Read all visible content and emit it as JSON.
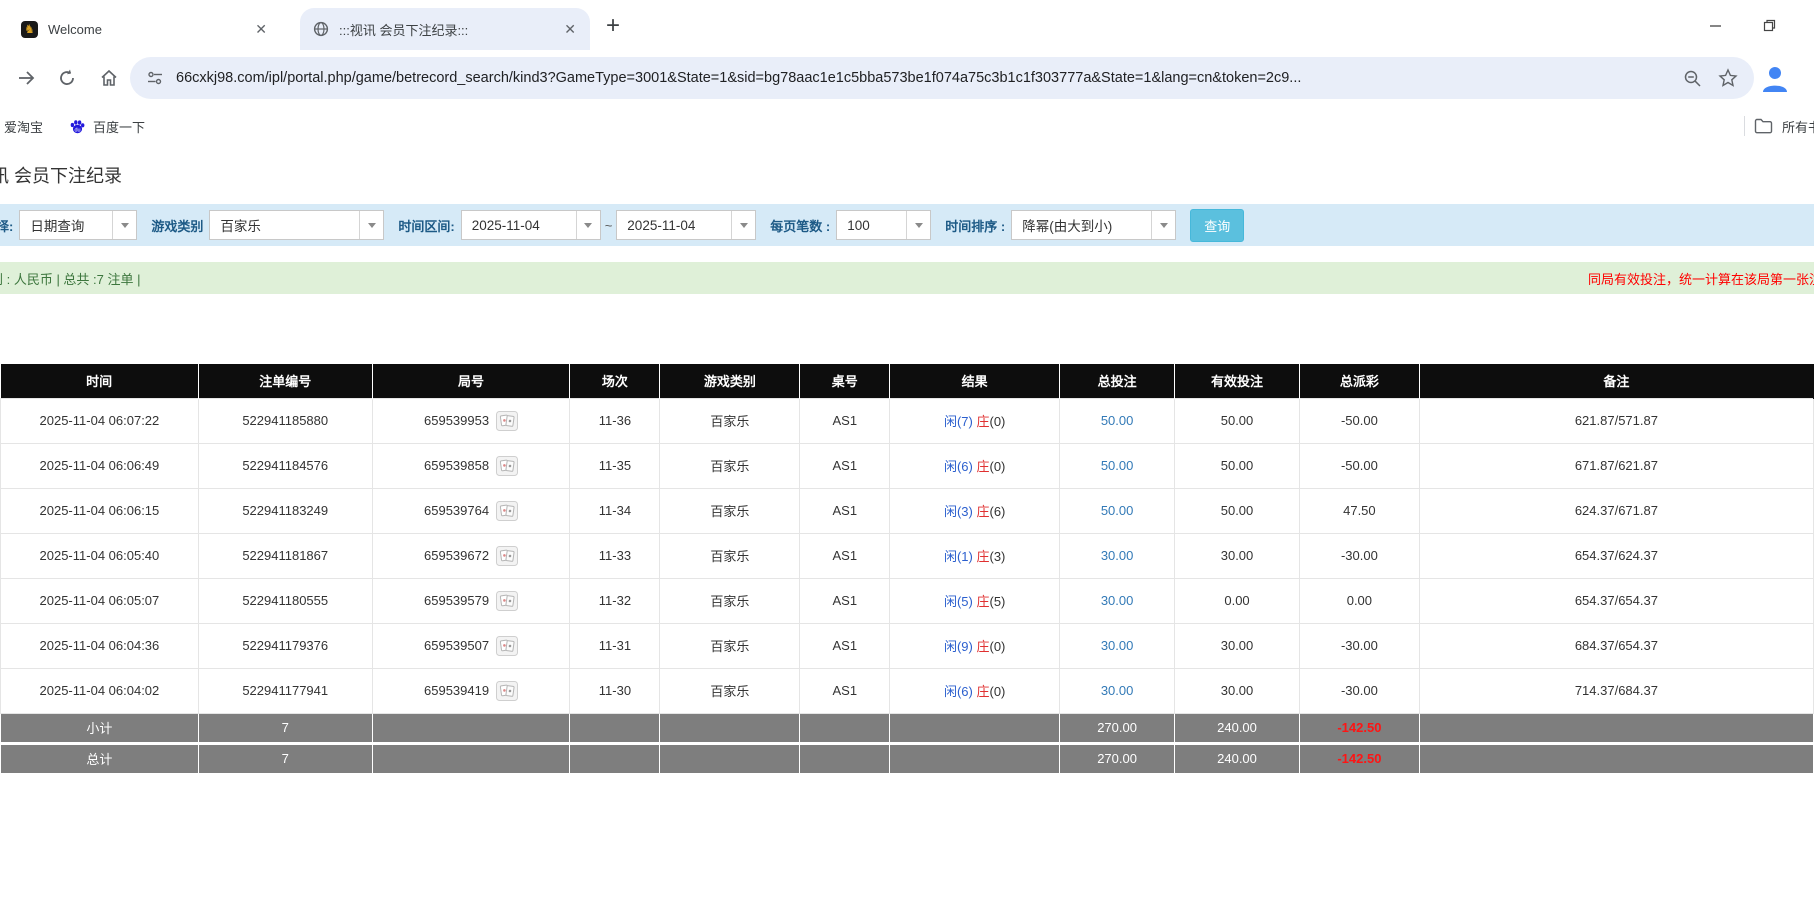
{
  "browser": {
    "tabs": [
      {
        "title": "Welcome",
        "favicon": "gold-emblem-icon"
      },
      {
        "title": ":::视讯 会员下注纪录:::",
        "favicon": "globe-icon"
      }
    ],
    "url": "66cxkj98.com/ipl/portal.php/game/betrecord_search/kind3?GameType=3001&State=1&sid=bg78aac1e1c5bba573be1f074a75c3b1c1f303777a&State=1&lang=cn&token=2c9...",
    "bookmarks": {
      "item1": "爱淘宝",
      "item2": "百度一下",
      "all_bookmarks": "所有书签"
    }
  },
  "page": {
    "heading": "讯 会员下注纪录",
    "filters": {
      "select_label": "择:",
      "query_type": "日期查询",
      "game_category_label": "游戏类别",
      "game_category": "百家乐",
      "date_range_label": "时间区间:",
      "date_from": "2025-11-04",
      "tilde": "~",
      "date_to": "2025-11-04",
      "page_size_label": "每页笔数 :",
      "page_size": "100",
      "sort_label": "时间排序 :",
      "sort_order": "降幂(由大到小)",
      "search_button": "查询"
    },
    "summary_bar": {
      "left": "别 : 人民币 | 总共 :7 注单 |",
      "right": "同局有效投注，统一计算在该局第一张注"
    },
    "table": {
      "headers": [
        "时间",
        "注单编号",
        "局号",
        "场次",
        "游戏类别",
        "桌号",
        "结果",
        "总投注",
        "有效投注",
        "总派彩",
        "备注"
      ],
      "rows": [
        {
          "time": "2025-11-04 06:07:22",
          "bet_id": "522941185880",
          "round": "659539953",
          "session": "11-36",
          "game_type": "百家乐",
          "table_no": "AS1",
          "result_player": "闲(7)",
          "result_banker": "庄",
          "result_banker_num": "(0)",
          "total_bet": "50.00",
          "valid_bet": "50.00",
          "payout": "-50.00",
          "remark": "621.87/571.87"
        },
        {
          "time": "2025-11-04 06:06:49",
          "bet_id": "522941184576",
          "round": "659539858",
          "session": "11-35",
          "game_type": "百家乐",
          "table_no": "AS1",
          "result_player": "闲(6)",
          "result_banker": "庄",
          "result_banker_num": "(0)",
          "total_bet": "50.00",
          "valid_bet": "50.00",
          "payout": "-50.00",
          "remark": "671.87/621.87"
        },
        {
          "time": "2025-11-04 06:06:15",
          "bet_id": "522941183249",
          "round": "659539764",
          "session": "11-34",
          "game_type": "百家乐",
          "table_no": "AS1",
          "result_player": "闲(3)",
          "result_banker": "庄",
          "result_banker_num": "(6)",
          "total_bet": "50.00",
          "valid_bet": "50.00",
          "payout": "47.50",
          "remark": "624.37/671.87"
        },
        {
          "time": "2025-11-04 06:05:40",
          "bet_id": "522941181867",
          "round": "659539672",
          "session": "11-33",
          "game_type": "百家乐",
          "table_no": "AS1",
          "result_player": "闲(1)",
          "result_banker": "庄",
          "result_banker_num": "(3)",
          "total_bet": "30.00",
          "valid_bet": "30.00",
          "payout": "-30.00",
          "remark": "654.37/624.37"
        },
        {
          "time": "2025-11-04 06:05:07",
          "bet_id": "522941180555",
          "round": "659539579",
          "session": "11-32",
          "game_type": "百家乐",
          "table_no": "AS1",
          "result_player": "闲(5)",
          "result_banker": "庄",
          "result_banker_num": "(5)",
          "total_bet": "30.00",
          "valid_bet": "0.00",
          "payout": "0.00",
          "remark": "654.37/654.37"
        },
        {
          "time": "2025-11-04 06:04:36",
          "bet_id": "522941179376",
          "round": "659539507",
          "session": "11-31",
          "game_type": "百家乐",
          "table_no": "AS1",
          "result_player": "闲(9)",
          "result_banker": "庄",
          "result_banker_num": "(0)",
          "total_bet": "30.00",
          "valid_bet": "30.00",
          "payout": "-30.00",
          "remark": "684.37/654.37"
        },
        {
          "time": "2025-11-04 06:04:02",
          "bet_id": "522941177941",
          "round": "659539419",
          "session": "11-30",
          "game_type": "百家乐",
          "table_no": "AS1",
          "result_player": "闲(6)",
          "result_banker": "庄",
          "result_banker_num": "(0)",
          "total_bet": "30.00",
          "valid_bet": "30.00",
          "payout": "-30.00",
          "remark": "714.37/684.37"
        }
      ],
      "footer": [
        {
          "label": "小计",
          "count": "7",
          "total_bet": "270.00",
          "valid_bet": "240.00",
          "payout": "-142.50"
        },
        {
          "label": "总计",
          "count": "7",
          "total_bet": "270.00",
          "valid_bet": "240.00",
          "payout": "-142.50"
        }
      ]
    }
  },
  "colors": {
    "filter_bar_bg": "#d6eaf7",
    "filter_label": "#1d5a86",
    "query_button_bg": "#5bc0de",
    "summary_bar_bg": "#dff0d8",
    "summary_text": "#3c763d",
    "alert_red": "#ff0000",
    "table_header_bg": "#0d0d0d",
    "footer_row_bg": "#7e7e7e",
    "bet_link_blue": "#337ab7",
    "player_blue": "#2b5fce",
    "banker_red": "#e03030",
    "active_tab_bg": "#e9eef9"
  }
}
